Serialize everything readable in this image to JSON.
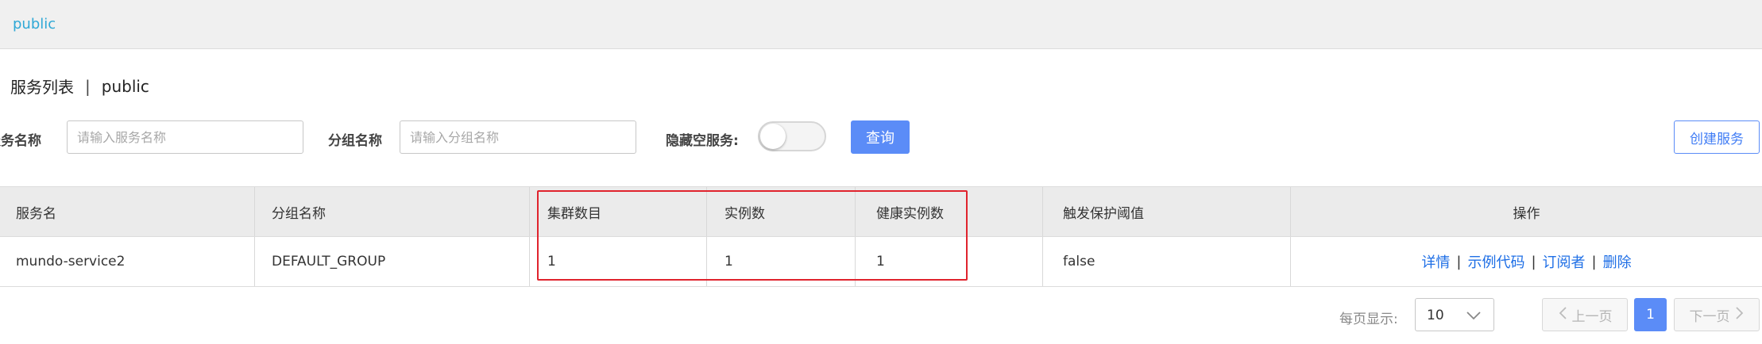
{
  "namespace_bar": {
    "active": "public"
  },
  "page": {
    "title": "服务列表",
    "separator": "|",
    "namespace": "public"
  },
  "filters": {
    "service_name_label": "服务名称",
    "service_name_placeholder": "请输入服务名称",
    "service_name_value": "",
    "group_name_label": "分组名称",
    "group_name_placeholder": "请输入分组名称",
    "group_name_value": "",
    "hide_empty_label": "隐藏空服务:",
    "hide_empty_on": false,
    "query_button": "查询",
    "create_button": "创建服务"
  },
  "table": {
    "columns": [
      "服务名",
      "分组名称",
      "集群数目",
      "实例数",
      "健康实例数",
      "触发保护阈值",
      "操作"
    ],
    "rows": [
      {
        "service": "mundo-service2",
        "group": "DEFAULT_GROUP",
        "clusters": "1",
        "instances": "1",
        "healthy": "1",
        "protect_threshold": "false",
        "actions": [
          "详情",
          "示例代码",
          "订阅者",
          "删除"
        ]
      }
    ]
  },
  "pagination": {
    "page_size_label": "每页显示:",
    "page_size": "10",
    "prev": "上一页",
    "current_page": "1",
    "next": "下一页"
  },
  "colors": {
    "accent": "#5b8cf7",
    "highlight_border": "#e0232d",
    "link": "#1f6fe6",
    "namespace": "#2fa8d6"
  }
}
